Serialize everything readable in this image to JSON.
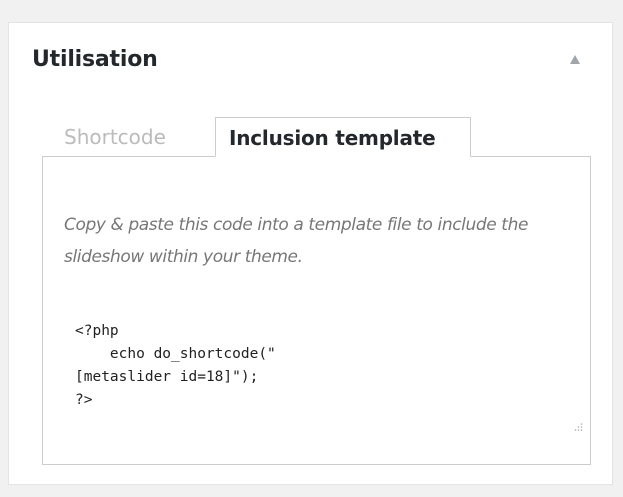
{
  "panel": {
    "title": "Utilisation",
    "toggle_icon": "triangle-up-icon"
  },
  "tabs": [
    {
      "label": "Shortcode",
      "active": false
    },
    {
      "label": "Inclusion template",
      "active": true
    }
  ],
  "inclusion": {
    "description": "Copy & paste this code into a template file to include the slideshow within your theme.",
    "code": "<?php\n    echo do_shortcode(\"\n[metaslider id=18]\");\n?>"
  },
  "colors": {
    "background": "#f1f1f1",
    "panel_border": "#e2e4e7",
    "tab_border": "#cccccc",
    "title_text": "#23282d",
    "inactive_tab_text": "#bbbbbb",
    "description_text": "#777777",
    "toggle_icon": "#a0a5aa"
  }
}
